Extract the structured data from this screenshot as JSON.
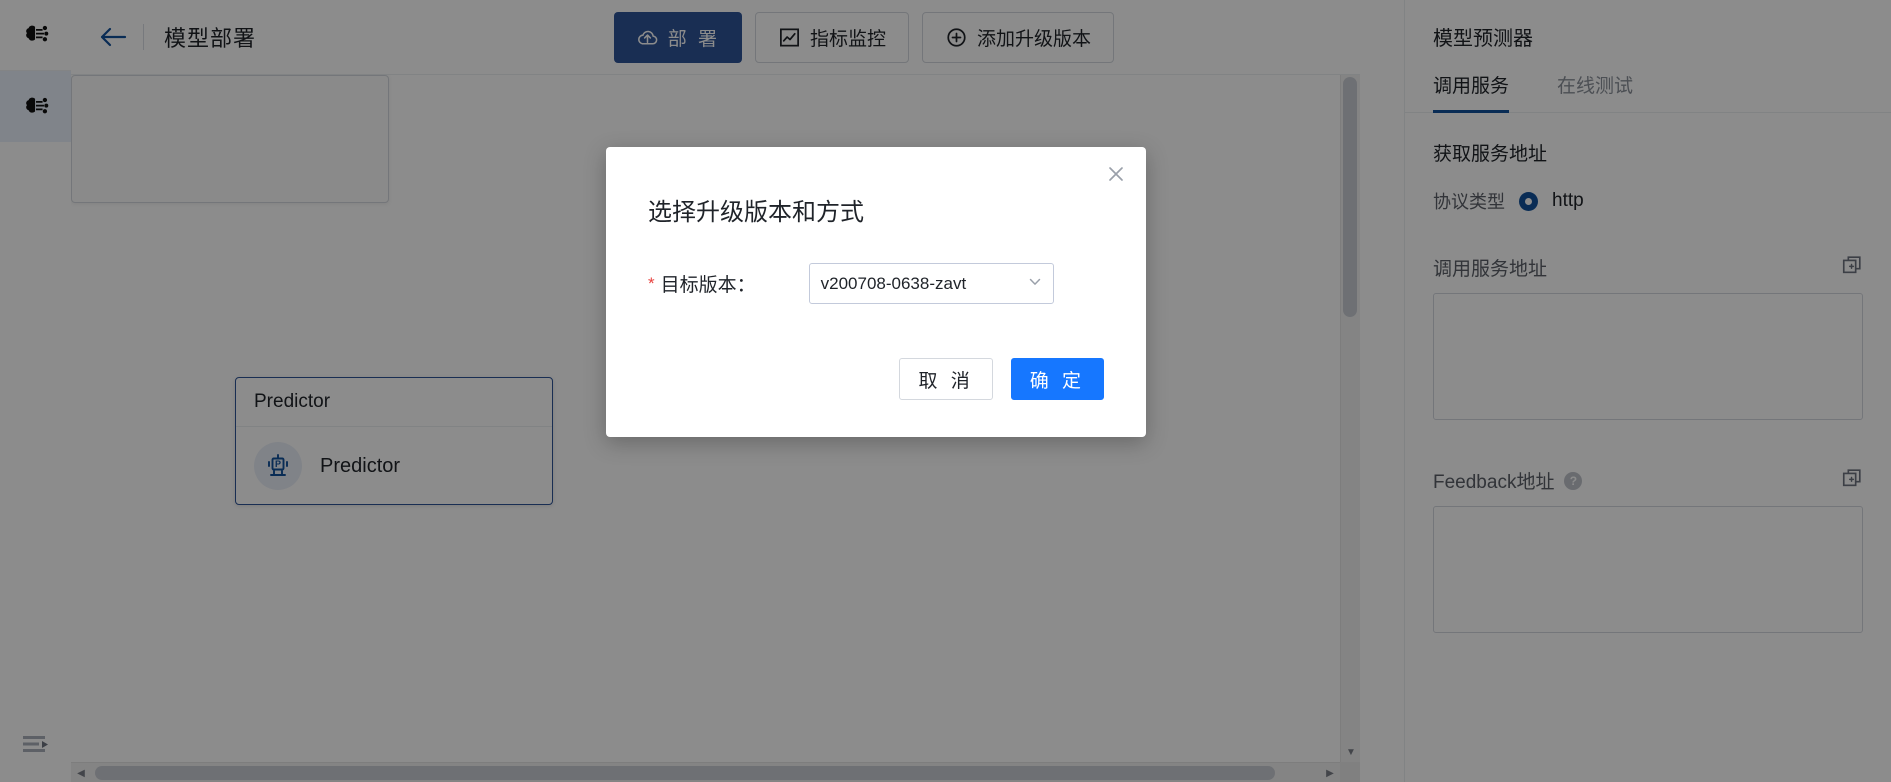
{
  "sidebar": {
    "logo_icon": "brain-ai-logo-icon",
    "items": [
      {
        "icon": "brain-ai-icon",
        "name": "model-workspace",
        "active": true
      }
    ],
    "bottom_icon": "expand-menu-icon"
  },
  "header": {
    "back_icon": "back-arrow-icon",
    "title": "模型部署",
    "actions": [
      {
        "label": "部 署",
        "icon": "cloud-upload-icon",
        "variant": "primary",
        "name": "deploy-button"
      },
      {
        "label": "指标监控",
        "icon": "chart-monitor-icon",
        "variant": "ghost",
        "name": "metrics-monitor-button"
      },
      {
        "label": "添加升级版本",
        "icon": "plus-circle-icon",
        "variant": "ghost",
        "name": "add-upgrade-version-button"
      }
    ]
  },
  "canvas": {
    "nodes": [
      {
        "header": "Predictor",
        "label": "Predictor",
        "icon": "predictor-robot-icon"
      }
    ],
    "scroll": {
      "up_arrow": "▲",
      "down_arrow": "▼",
      "left_arrow": "◀",
      "right_arrow": "▶"
    }
  },
  "right_panel": {
    "title": "模型预测器",
    "tabs": [
      {
        "label": "调用服务",
        "active": true,
        "name": "tab-invoke-service"
      },
      {
        "label": "在线测试",
        "active": false,
        "name": "tab-online-test"
      }
    ],
    "section_heading": "获取服务地址",
    "protocol": {
      "label": "协议类型",
      "selected": "http"
    },
    "fields": [
      {
        "label": "调用服务地址",
        "value": "",
        "placeholder": "",
        "copy_icon": "copy-icon",
        "has_help": false,
        "name": "service-url-field"
      },
      {
        "label": "Feedback地址",
        "value": "",
        "placeholder": "",
        "copy_icon": "copy-icon",
        "has_help": true,
        "help_icon": "question-mark-icon",
        "name": "feedback-url-field"
      }
    ]
  },
  "modal": {
    "title": "选择升级版本和方式",
    "close_icon": "close-icon",
    "required_marker": "*",
    "form": {
      "label": "目标版本：",
      "value": "v200708-0638-zavt",
      "caret_icon": "chevron-down-icon"
    },
    "buttons": {
      "cancel": "取 消",
      "confirm": "确 定"
    }
  },
  "colors": {
    "accent_blue": "#1677ff",
    "nav_blue": "#11519b",
    "primary_button": "#2f5597",
    "required_red": "#e8423f",
    "node_border": "#2f5597"
  }
}
